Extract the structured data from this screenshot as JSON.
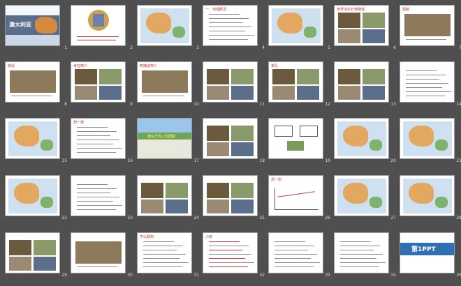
{
  "slides": [
    {
      "n": "1",
      "kind": "title",
      "title": "澳大利亚"
    },
    {
      "n": "2",
      "kind": "emblem"
    },
    {
      "n": "3",
      "kind": "map"
    },
    {
      "n": "4",
      "kind": "list",
      "title": "一、地理概况"
    },
    {
      "n": "5",
      "kind": "map"
    },
    {
      "n": "6",
      "kind": "photos",
      "title": "世界活化石博物馆"
    },
    {
      "n": "7",
      "kind": "photo",
      "title": "鸸鹋"
    },
    {
      "n": "8",
      "kind": "photo",
      "title": "袋鼠"
    },
    {
      "n": "9",
      "kind": "photos",
      "title": "考拉简介"
    },
    {
      "n": "10",
      "kind": "photo",
      "title": "鸭嘴兽简介"
    },
    {
      "n": "11",
      "kind": "photos"
    },
    {
      "n": "12",
      "kind": "photos",
      "title": "单孔"
    },
    {
      "n": "13",
      "kind": "photos"
    },
    {
      "n": "14",
      "kind": "list"
    },
    {
      "n": "15",
      "kind": "map"
    },
    {
      "n": "16",
      "kind": "list",
      "title": "想一想"
    },
    {
      "n": "17",
      "kind": "green",
      "title": "骑在羊背上的国家"
    },
    {
      "n": "18",
      "kind": "photos"
    },
    {
      "n": "19",
      "kind": "diagram"
    },
    {
      "n": "20",
      "kind": "map"
    },
    {
      "n": "21",
      "kind": "map"
    },
    {
      "n": "22",
      "kind": "map"
    },
    {
      "n": "23",
      "kind": "list"
    },
    {
      "n": "24",
      "kind": "photos"
    },
    {
      "n": "25",
      "kind": "photos"
    },
    {
      "n": "26",
      "kind": "chart",
      "title": "想一想"
    },
    {
      "n": "27",
      "kind": "map"
    },
    {
      "n": "28",
      "kind": "map"
    },
    {
      "n": "29",
      "kind": "photos"
    },
    {
      "n": "30",
      "kind": "photo"
    },
    {
      "n": "31",
      "kind": "list",
      "title": "学以致用"
    },
    {
      "n": "32",
      "kind": "summary",
      "title": "小结"
    },
    {
      "n": "33",
      "kind": "list"
    },
    {
      "n": "34",
      "kind": "list"
    },
    {
      "n": "35",
      "kind": "brand",
      "title": "第1PPT"
    }
  ]
}
